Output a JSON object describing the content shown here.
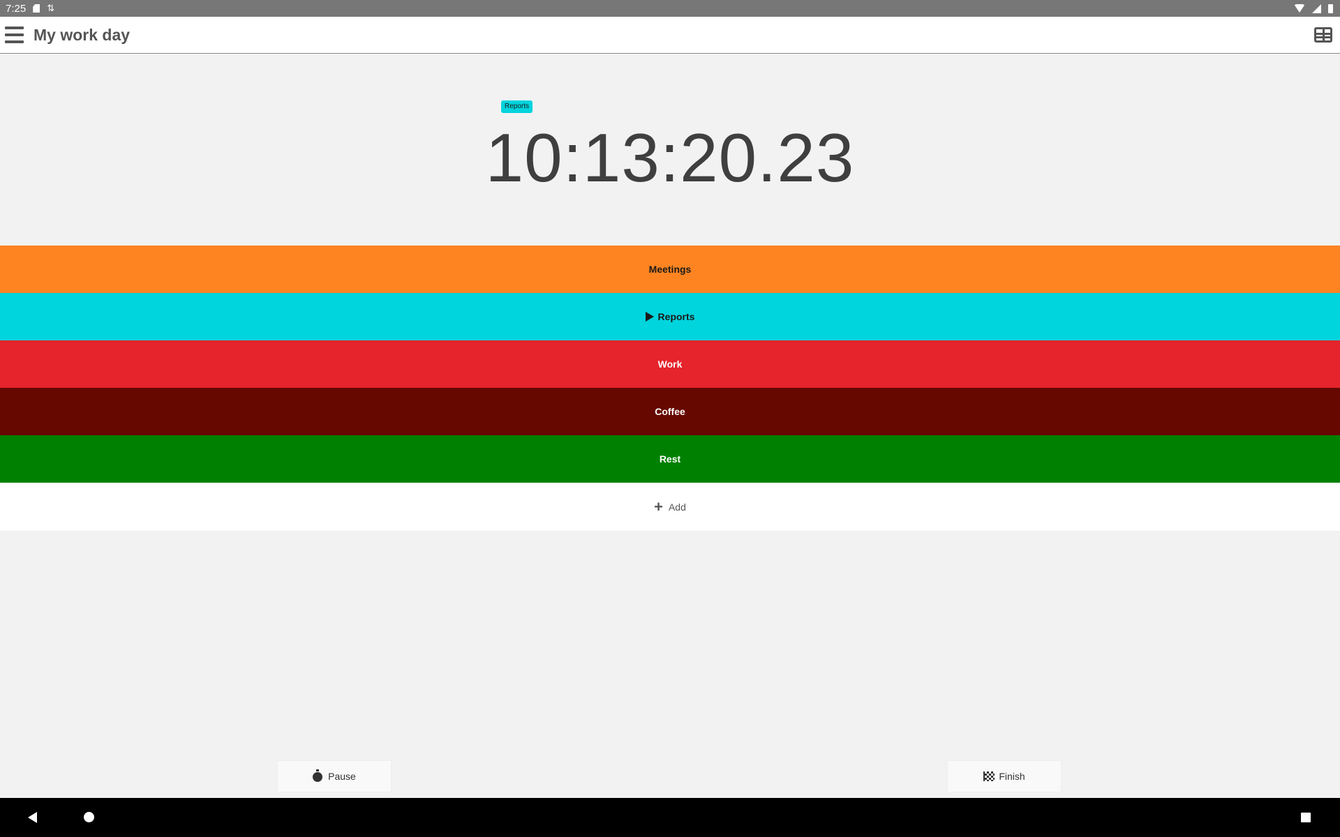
{
  "status_bar": {
    "time": "7:25",
    "icons_left": [
      "sd-card-icon",
      "sync-icon"
    ],
    "icons_right": [
      "wifi-icon",
      "signal-icon",
      "battery-icon"
    ]
  },
  "app_bar": {
    "title": "My work day",
    "icons": [
      "menu-icon",
      "table-view-icon"
    ]
  },
  "timer": {
    "current_activity": "Reports",
    "current_activity_color": "#00d4dd",
    "elapsed": "10:13:20.23"
  },
  "activities": [
    {
      "label": "Meetings",
      "color": "#fd8421",
      "text_color": "#1a1a1a",
      "playing": false
    },
    {
      "label": "Reports",
      "color": "#00d4dd",
      "text_color": "#1a1a1a",
      "playing": true
    },
    {
      "label": "Work",
      "color": "#e5242c",
      "text_color": "#ffffff",
      "playing": false
    },
    {
      "label": "Coffee",
      "color": "#660800",
      "text_color": "#ffffff",
      "playing": false
    },
    {
      "label": "Rest",
      "color": "#008000",
      "text_color": "#ffffff",
      "playing": false
    }
  ],
  "add_row": {
    "label": "Add",
    "icon": "plus-icon"
  },
  "buttons": {
    "pause_label": "Pause",
    "pause_icon": "stopwatch-icon",
    "finish_label": "Finish",
    "finish_icon": "checkered-flag-icon"
  },
  "nav_bar": {
    "icons": [
      "back-icon",
      "home-icon",
      "recents-icon"
    ]
  }
}
